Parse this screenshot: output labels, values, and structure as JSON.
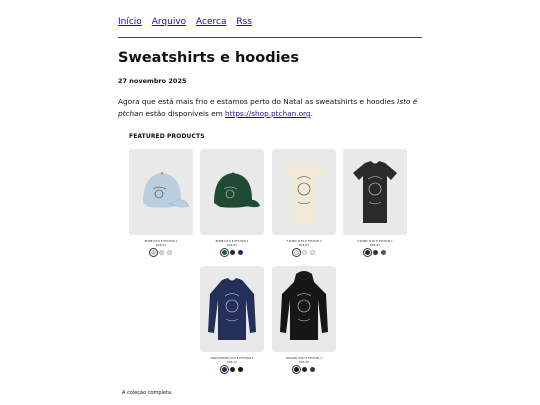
{
  "nav": {
    "items": [
      "Início",
      "Arquivo",
      "Acerca",
      "Rss"
    ]
  },
  "post": {
    "title": "Sweatshirts e hoodies",
    "date": "27 novembro 2025",
    "body_start": "Agora que está mais frio e estamos perto do Natal as sweatshirts e hoodies ",
    "body_em": "Isto é ptchan",
    "body_mid": " estão disponíveis em ",
    "link": "https://shop.ptchan.org",
    "body_end": "."
  },
  "section": {
    "label": "FEATURED PRODUCTS"
  },
  "products": [
    {
      "name": "BONÉ ISTO É PTCHAN 1",
      "price": "€24,63",
      "icon": "cap",
      "color": "#b9cfe0",
      "swatches": [
        "#c3ced8",
        "#f2c6cf",
        "#f3d7dc"
      ]
    },
    {
      "name": "BONÉ ISTO É PTCHAN 1",
      "price": "€24,63",
      "icon": "cap",
      "color": "#1f4a33",
      "swatches": [
        "#1f5a3c",
        "#2a2a2a",
        "#1a2a5a"
      ]
    },
    {
      "name": "T-SHIRT ISTO É PTCHAN 1",
      "price": "€24,63",
      "icon": "tshirt",
      "color": "#f1ead8",
      "swatches": [
        "#ffffff",
        "#f4f0e4",
        "#eeeeee"
      ]
    },
    {
      "name": "T-SHIRT ISTO É PTCHAN 1",
      "price": "€24,63",
      "icon": "tshirt",
      "color": "#2a2a2a",
      "swatches": [
        "#2a2a2a",
        "#333333",
        "#555555"
      ]
    },
    {
      "name": "SWEATSHIRT ISTO É PTCHAN 1",
      "price": "€35,15",
      "icon": "sweatshirt",
      "color": "#25305a",
      "swatches": [
        "#25305a",
        "#1c1c1c",
        "#111111"
      ]
    },
    {
      "name": "HOODIE ISTO É PTCHAN 1",
      "price": "€43,95",
      "icon": "hoodie",
      "color": "#161616",
      "swatches": [
        "#161616",
        "#222222",
        "#333333"
      ]
    }
  ],
  "caption": "A coleção completa."
}
